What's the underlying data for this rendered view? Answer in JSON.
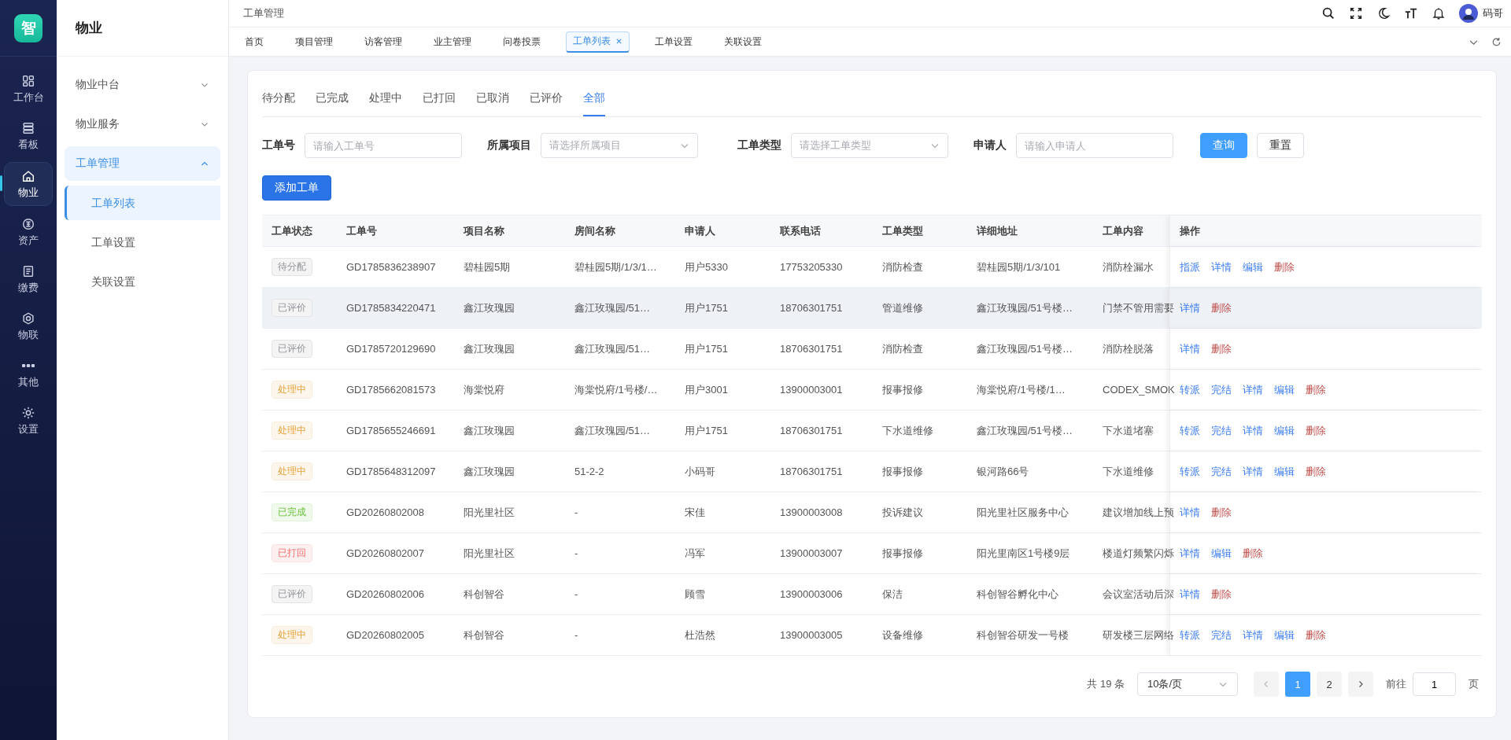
{
  "logo": "智",
  "rail": [
    {
      "label": "工作台",
      "selected": false
    },
    {
      "label": "看板",
      "selected": false
    },
    {
      "label": "物业",
      "selected": true
    },
    {
      "label": "资产",
      "selected": false
    },
    {
      "label": "缴费",
      "selected": false
    },
    {
      "label": "物联",
      "selected": false
    },
    {
      "label": "其他",
      "selected": false
    },
    {
      "label": "设置",
      "selected": false
    }
  ],
  "submenu": {
    "title": "物业",
    "items": [
      {
        "label": "物业中台",
        "expanded": false
      },
      {
        "label": "物业服务",
        "expanded": false
      },
      {
        "label": "工单管理",
        "expanded": true,
        "children": [
          {
            "label": "工单列表",
            "selected": true
          },
          {
            "label": "工单设置",
            "selected": false
          },
          {
            "label": "关联设置",
            "selected": false
          }
        ]
      }
    ]
  },
  "header": {
    "breadcrumb": "工单管理",
    "user": "码哥"
  },
  "page_tabs": [
    {
      "label": "首页",
      "selected": false,
      "closable": false
    },
    {
      "label": "项目管理",
      "selected": false,
      "closable": false
    },
    {
      "label": "访客管理",
      "selected": false,
      "closable": false
    },
    {
      "label": "业主管理",
      "selected": false,
      "closable": false
    },
    {
      "label": "问卷投票",
      "selected": false,
      "closable": false
    },
    {
      "label": "工单列表",
      "selected": true,
      "closable": true
    },
    {
      "label": "工单设置",
      "selected": false,
      "closable": false
    },
    {
      "label": "关联设置",
      "selected": false,
      "closable": false
    }
  ],
  "status_tabs": [
    {
      "label": "待分配",
      "selected": false
    },
    {
      "label": "已完成",
      "selected": false
    },
    {
      "label": "处理中",
      "selected": false
    },
    {
      "label": "已打回",
      "selected": false
    },
    {
      "label": "已取消",
      "selected": false
    },
    {
      "label": "已评价",
      "selected": false
    },
    {
      "label": "全部",
      "selected": true
    }
  ],
  "filters": [
    {
      "label": "工单号",
      "kind": "input",
      "placeholder": "请输入工单号"
    },
    {
      "label": "所属项目",
      "kind": "select",
      "placeholder": "请选择所属项目"
    },
    {
      "label": "工单类型",
      "kind": "select",
      "placeholder": "请选择工单类型"
    },
    {
      "label": "申请人",
      "kind": "input",
      "placeholder": "请输入申请人"
    }
  ],
  "buttons": {
    "search": "查询",
    "reset": "重置",
    "add": "添加工单"
  },
  "table": {
    "columns": [
      "工单状态",
      "工单号",
      "项目名称",
      "房间名称",
      "申请人",
      "联系电话",
      "工单类型",
      "详细地址",
      "工单内容",
      "操作"
    ],
    "rows": [
      {
        "hovered": false,
        "kind": "pending",
        "cells": [
          "待分配",
          "GD1785836238907",
          "碧桂园5期",
          "碧桂园5期/1/3/1…",
          "用户5330",
          "17753205330",
          "消防检查",
          "碧桂园5期/1/3/101",
          "消防栓漏水"
        ],
        "actions": [
          {
            "text": "指派",
            "kind": "primary"
          },
          {
            "text": "详情",
            "kind": "primary"
          },
          {
            "text": "编辑",
            "kind": "primary"
          },
          {
            "text": "删除",
            "kind": "danger"
          }
        ]
      },
      {
        "hovered": true,
        "kind": "rated",
        "cells": [
          "已评价",
          "GD1785834220471",
          "鑫江玫瑰园",
          "鑫江玫瑰园/51…",
          "用户1751",
          "18706301751",
          "管道维修",
          "鑫江玫瑰园/51号楼…",
          "门禁不管用需要"
        ],
        "actions": [
          {
            "text": "详情",
            "kind": "primary"
          },
          {
            "text": "删除",
            "kind": "danger"
          }
        ]
      },
      {
        "hovered": false,
        "kind": "rated",
        "cells": [
          "已评价",
          "GD1785720129690",
          "鑫江玫瑰园",
          "鑫江玫瑰园/51…",
          "用户1751",
          "18706301751",
          "消防检查",
          "鑫江玫瑰园/51号楼…",
          "消防栓脱落"
        ],
        "actions": [
          {
            "text": "详情",
            "kind": "primary"
          },
          {
            "text": "删除",
            "kind": "danger"
          }
        ]
      },
      {
        "hovered": false,
        "kind": "processing",
        "cells": [
          "处理中",
          "GD1785662081573",
          "海棠悦府",
          "海棠悦府/1号楼/…",
          "用户3001",
          "13900003001",
          "报事报修",
          "海棠悦府/1号楼/1…",
          "CODEX_SMOK"
        ],
        "actions": [
          {
            "text": "转派",
            "kind": "primary"
          },
          {
            "text": "完结",
            "kind": "primary"
          },
          {
            "text": "详情",
            "kind": "primary"
          },
          {
            "text": "编辑",
            "kind": "primary"
          },
          {
            "text": "删除",
            "kind": "danger"
          }
        ]
      },
      {
        "hovered": false,
        "kind": "processing",
        "cells": [
          "处理中",
          "GD1785655246691",
          "鑫江玫瑰园",
          "鑫江玫瑰园/51…",
          "用户1751",
          "18706301751",
          "下水道维修",
          "鑫江玫瑰园/51号楼…",
          "下水道堵塞"
        ],
        "actions": [
          {
            "text": "转派",
            "kind": "primary"
          },
          {
            "text": "完结",
            "kind": "primary"
          },
          {
            "text": "详情",
            "kind": "primary"
          },
          {
            "text": "编辑",
            "kind": "primary"
          },
          {
            "text": "删除",
            "kind": "danger"
          }
        ]
      },
      {
        "hovered": false,
        "kind": "processing",
        "cells": [
          "处理中",
          "GD1785648312097",
          "鑫江玫瑰园",
          "51-2-2",
          "小码哥",
          "18706301751",
          "报事报修",
          "银河路66号",
          "下水道维修"
        ],
        "actions": [
          {
            "text": "转派",
            "kind": "primary"
          },
          {
            "text": "完结",
            "kind": "primary"
          },
          {
            "text": "详情",
            "kind": "primary"
          },
          {
            "text": "编辑",
            "kind": "primary"
          },
          {
            "text": "删除",
            "kind": "danger"
          }
        ]
      },
      {
        "hovered": false,
        "kind": "done",
        "cells": [
          "已完成",
          "GD20260802008",
          "阳光里社区",
          "-",
          "宋佳",
          "13900003008",
          "投诉建议",
          "阳光里社区服务中心",
          "建议增加线上预"
        ],
        "actions": [
          {
            "text": "详情",
            "kind": "primary"
          },
          {
            "text": "删除",
            "kind": "danger"
          }
        ]
      },
      {
        "hovered": false,
        "kind": "rejected",
        "cells": [
          "已打回",
          "GD20260802007",
          "阳光里社区",
          "-",
          "冯军",
          "13900003007",
          "报事报修",
          "阳光里南区1号楼9层",
          "楼道灯频繁闪烁"
        ],
        "actions": [
          {
            "text": "详情",
            "kind": "primary"
          },
          {
            "text": "编辑",
            "kind": "primary"
          },
          {
            "text": "删除",
            "kind": "danger"
          }
        ]
      },
      {
        "hovered": false,
        "kind": "rated",
        "cells": [
          "已评价",
          "GD20260802006",
          "科创智谷",
          "-",
          "顾雪",
          "13900003006",
          "保洁",
          "科创智谷孵化中心",
          "会议室活动后深"
        ],
        "actions": [
          {
            "text": "详情",
            "kind": "primary"
          },
          {
            "text": "删除",
            "kind": "danger"
          }
        ]
      },
      {
        "hovered": false,
        "kind": "processing",
        "cells": [
          "处理中",
          "GD20260802005",
          "科创智谷",
          "-",
          "杜浩然",
          "13900003005",
          "设备维修",
          "科创智谷研发一号楼",
          "研发楼三层网络"
        ],
        "actions": [
          {
            "text": "转派",
            "kind": "primary"
          },
          {
            "text": "完结",
            "kind": "primary"
          },
          {
            "text": "详情",
            "kind": "primary"
          },
          {
            "text": "编辑",
            "kind": "primary"
          },
          {
            "text": "删除",
            "kind": "danger"
          }
        ]
      }
    ]
  },
  "pagination": {
    "total": "共 19 条",
    "page_size": "10条/页",
    "pages": [
      {
        "label": "1",
        "selected": true
      },
      {
        "label": "2",
        "selected": false
      }
    ],
    "goto_label": "前往",
    "goto_value": "1",
    "goto_suffix": "页"
  }
}
